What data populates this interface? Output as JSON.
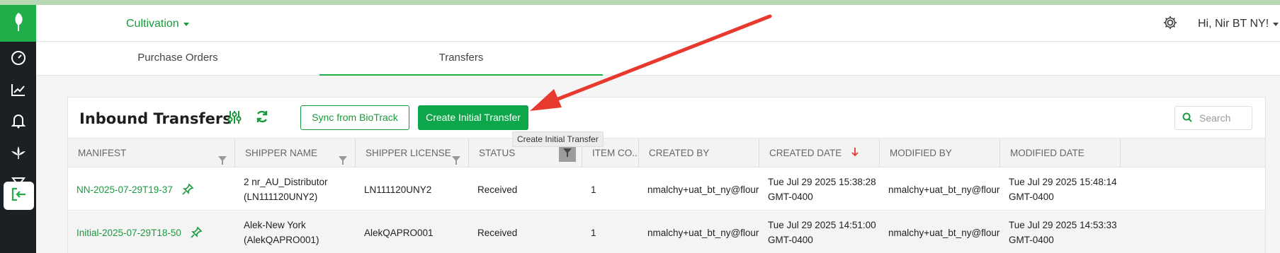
{
  "header": {
    "nav_dropdown": "Cultivation",
    "user_greeting": "Hi, Nir BT NY!"
  },
  "tabs": [
    {
      "label": "Purchase Orders"
    },
    {
      "label": "Transfers"
    }
  ],
  "card": {
    "title": "Inbound Transfers",
    "sync_label": "Sync from BioTrack",
    "create_label": "Create Initial Transfer",
    "tooltip": "Create Initial Transfer",
    "search_placeholder": "Search"
  },
  "table": {
    "columns": [
      "MANIFEST",
      "SHIPPER NAME",
      "SHIPPER LICENSE",
      "STATUS",
      "ITEM CO...",
      "CREATED BY",
      "CREATED DATE",
      "MODIFIED BY",
      "MODIFIED DATE"
    ],
    "rows": [
      {
        "manifest": "NN-2025-07-29T19-37",
        "shipper_name_1": "2 nr_AU_Distributor",
        "shipper_name_2": "(LN111120UNY2)",
        "shipper_license": "LN111120UNY2",
        "status": "Received",
        "item_count": "1",
        "created_by": "nmalchy+uat_bt_ny@flouri...",
        "created_date_1": "Tue Jul 29 2025 15:38:28",
        "created_date_2": "GMT-0400",
        "modified_by": "nmalchy+uat_bt_ny@flouri...",
        "modified_date_1": "Tue Jul 29 2025 15:48:14",
        "modified_date_2": "GMT-0400"
      },
      {
        "manifest": "Initial-2025-07-29T18-50",
        "shipper_name_1": "Alek-New York",
        "shipper_name_2": "(AlekQAPRO001)",
        "shipper_license": "AlekQAPRO001",
        "status": "Received",
        "item_count": "1",
        "created_by": "nmalchy+uat_bt_ny@flouri...",
        "created_date_1": "Tue Jul 29 2025 14:51:00",
        "created_date_2": "GMT-0400",
        "modified_by": "nmalchy+uat_bt_ny@flouri...",
        "modified_date_1": "Tue Jul 29 2025 14:53:33",
        "modified_date_2": "GMT-0400"
      }
    ]
  },
  "colors": {
    "brand_green": "#1fae49",
    "link_green": "#1a9a3d",
    "sidebar_bg": "#1b2025",
    "arrow_red": "#e8392e"
  },
  "icons": [
    "leaf-logo-icon",
    "dashboard-icon",
    "chart-icon",
    "bell-icon",
    "cannabis-icon",
    "funnel-icon",
    "transfer-in-icon",
    "gear-icon",
    "sliders-icon",
    "refresh-icon",
    "search-icon",
    "filter-icon",
    "sort-down-icon",
    "pin-icon"
  ]
}
